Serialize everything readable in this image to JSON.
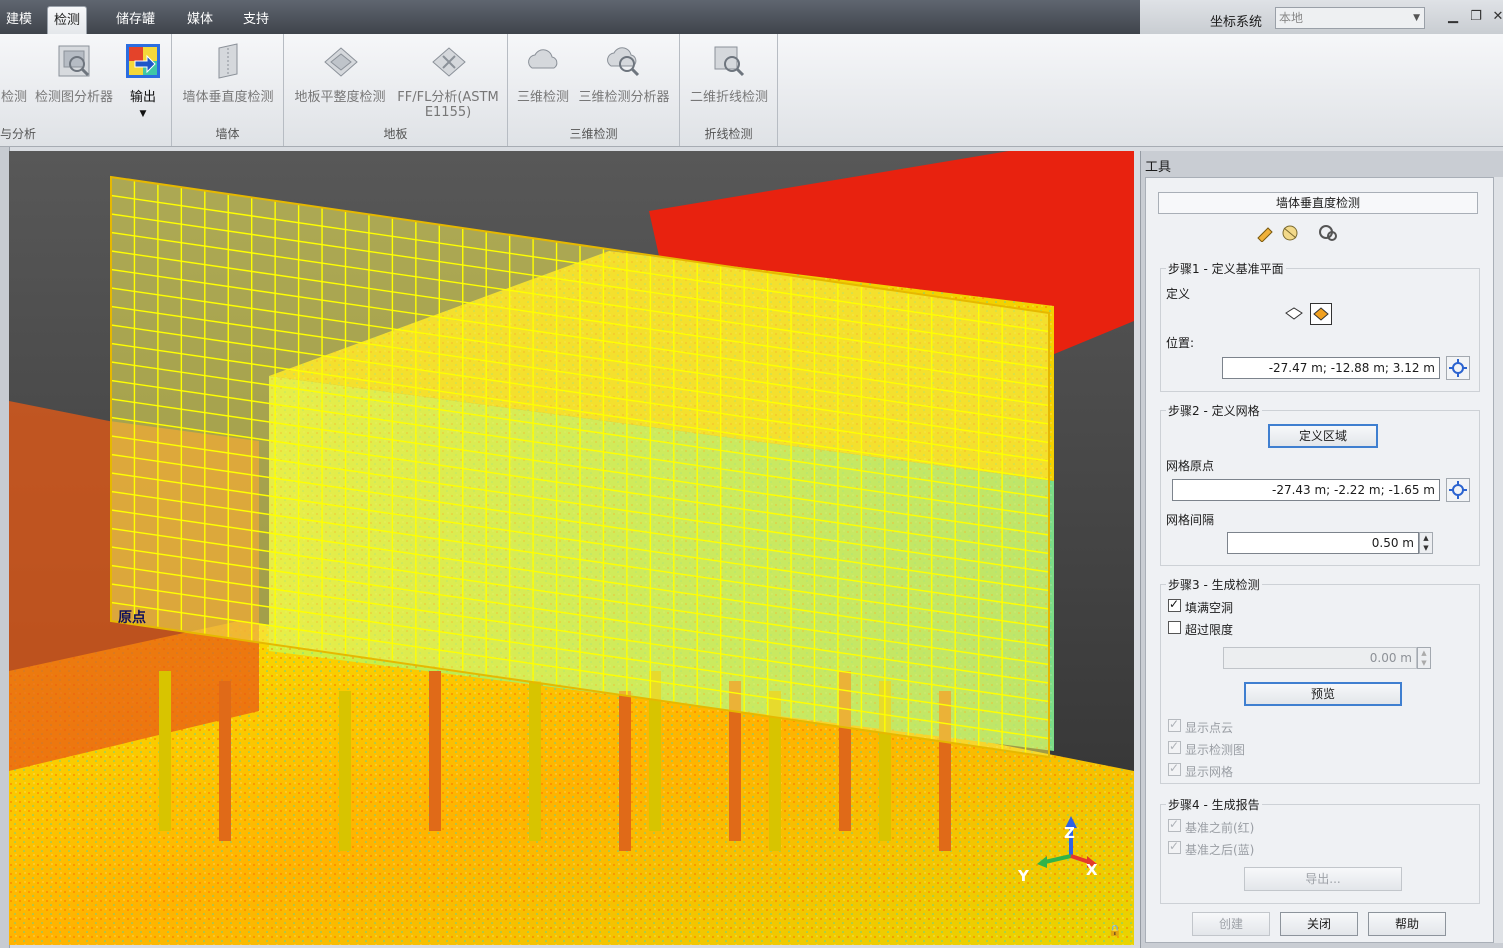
{
  "tabs": [
    {
      "label": "建模",
      "active": false
    },
    {
      "label": "检测",
      "active": true
    },
    {
      "label": "储存罐",
      "active": false
    },
    {
      "label": "媒体",
      "active": false
    },
    {
      "label": "支持",
      "active": false
    }
  ],
  "coord_system": {
    "label": "坐标系统",
    "value": "本地"
  },
  "ribbon": {
    "group0": {
      "label": "与分析",
      "btn_a": "检测",
      "btn_b": "检测图分析器",
      "btn_c": "输出"
    },
    "group1": {
      "label": "墙体",
      "btn_a": "墙体垂直度检测"
    },
    "group2": {
      "label": "地板",
      "btn_a": "地板平整度检测",
      "btn_b_line1": "FF/FL分析(ASTM",
      "btn_b_line2": "E1155)"
    },
    "group3": {
      "label": "三维检测",
      "btn_a": "三维检测",
      "btn_b": "三维检测分析器"
    },
    "group4": {
      "label": "折线检测",
      "btn_a": "二维折线检测"
    }
  },
  "viewport": {
    "origin_label": "原点",
    "axes": {
      "z": "Z",
      "y": "Y",
      "x": "X"
    },
    "colors": {
      "grid": "#ffff00",
      "grid_fill": "#f2e85a",
      "floor": "#e8220f"
    }
  },
  "panel": {
    "title": "工具",
    "tool_name": "墙体垂直度检测",
    "step1": {
      "title": "步骤1 - 定义基准平面",
      "define_label": "定义",
      "position_label": "位置:",
      "position_value": "-27.47 m; -12.88 m; 3.12 m"
    },
    "step2": {
      "title": "步骤2 - 定义网格",
      "define_area_button": "定义区域",
      "grid_origin_label": "网格原点",
      "grid_origin_value": "-27.43 m; -2.22 m; -1.65 m",
      "grid_spacing_label": "网格间隔",
      "grid_spacing_value": "0.50 m"
    },
    "step3": {
      "title": "步骤3 - 生成检测",
      "fill_holes": {
        "label": "填满空洞",
        "checked": true
      },
      "exceed_limit": {
        "label": "超过限度",
        "checked": false
      },
      "limit_value": "0.00 m",
      "preview_button": "预览",
      "show_cloud": {
        "label": "显示点云",
        "checked": true
      },
      "show_map": {
        "label": "显示检测图",
        "checked": true
      },
      "show_grid": {
        "label": "显示网格",
        "checked": true
      }
    },
    "step4": {
      "title": "步骤4 - 生成报告",
      "before_ref": {
        "label": "基准之前(红)",
        "checked": true
      },
      "after_ref": {
        "label": "基准之后(蓝)",
        "checked": true
      },
      "export_button": "导出..."
    },
    "footer": {
      "create": "创建",
      "close": "关闭",
      "help": "帮助"
    }
  }
}
